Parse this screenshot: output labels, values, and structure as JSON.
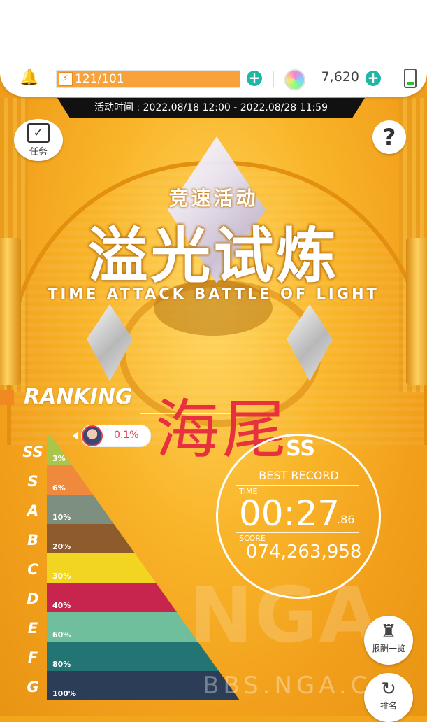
{
  "topbar": {
    "energy": "121/101",
    "gems": "7,620"
  },
  "event": {
    "period": "活动时间 : 2022.08/18 12:00 - 2022.08/28 11:59",
    "subtitle": "竞速活动",
    "title": "溢光试炼",
    "title_en": "TIME ATTACK BATTLE OF LIGHT"
  },
  "buttons": {
    "mission": "任务",
    "help": "?",
    "rewards": "报酬一览",
    "leaderboard": "排名"
  },
  "ranking": {
    "label": "RANKING",
    "player_percent": "0.1%",
    "tiers": [
      {
        "rank": "SS",
        "percent": "3%",
        "color": "#a9c64a"
      },
      {
        "rank": "S",
        "percent": "6%",
        "color": "#ef8a3c"
      },
      {
        "rank": "A",
        "percent": "10%",
        "color": "#7d8f7f"
      },
      {
        "rank": "B",
        "percent": "20%",
        "color": "#8e5b2c"
      },
      {
        "rank": "C",
        "percent": "30%",
        "color": "#f1d521"
      },
      {
        "rank": "D",
        "percent": "40%",
        "color": "#c8254e"
      },
      {
        "rank": "E",
        "percent": "60%",
        "color": "#6fbf9c"
      },
      {
        "rank": "F",
        "percent": "80%",
        "color": "#237574"
      },
      {
        "rank": "G",
        "percent": "100%",
        "color": "#2c3d57"
      }
    ]
  },
  "record": {
    "rank": "SS",
    "label": "BEST RECORD",
    "time_label": "TIME",
    "time": "00:27",
    "time_ms": ".86",
    "score_label": "SCORE",
    "score": "074,263,958"
  },
  "overlay": "海尾",
  "watermark": {
    "logo": "NGA",
    "url": "BBS.NGA.C"
  }
}
